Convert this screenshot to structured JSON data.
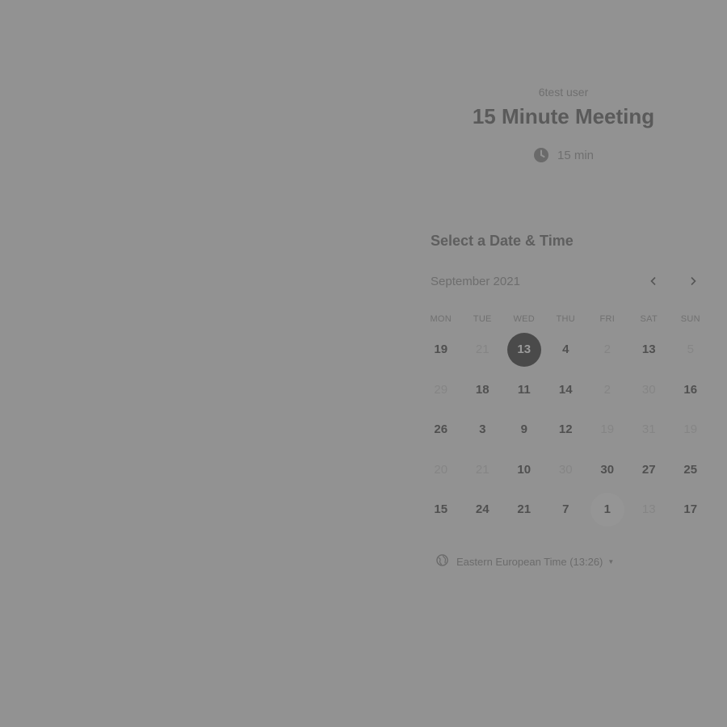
{
  "event": {
    "owner": "6test user",
    "title": "15 Minute Meeting",
    "duration": "15 min"
  },
  "scheduler": {
    "heading": "Select a Date & Time",
    "month": "September 2021",
    "weekdays": [
      "MON",
      "TUE",
      "WED",
      "THU",
      "FRI",
      "SAT",
      "SUN"
    ],
    "days": [
      {
        "label": "19",
        "state": "available"
      },
      {
        "label": "21",
        "state": "unavailable"
      },
      {
        "label": "13",
        "state": "selected"
      },
      {
        "label": "4",
        "state": "available"
      },
      {
        "label": "2",
        "state": "unavailable"
      },
      {
        "label": "13",
        "state": "available"
      },
      {
        "label": "5",
        "state": "unavailable"
      },
      {
        "label": "29",
        "state": "unavailable"
      },
      {
        "label": "18",
        "state": "available"
      },
      {
        "label": "11",
        "state": "available"
      },
      {
        "label": "14",
        "state": "available"
      },
      {
        "label": "2",
        "state": "unavailable"
      },
      {
        "label": "30",
        "state": "unavailable"
      },
      {
        "label": "16",
        "state": "available"
      },
      {
        "label": "26",
        "state": "available"
      },
      {
        "label": "3",
        "state": "available"
      },
      {
        "label": "9",
        "state": "available"
      },
      {
        "label": "12",
        "state": "available"
      },
      {
        "label": "19",
        "state": "unavailable"
      },
      {
        "label": "31",
        "state": "unavailable"
      },
      {
        "label": "19",
        "state": "unavailable"
      },
      {
        "label": "20",
        "state": "unavailable"
      },
      {
        "label": "21",
        "state": "unavailable"
      },
      {
        "label": "10",
        "state": "available"
      },
      {
        "label": "30",
        "state": "unavailable"
      },
      {
        "label": "30",
        "state": "available"
      },
      {
        "label": "27",
        "state": "available"
      },
      {
        "label": "25",
        "state": "available"
      },
      {
        "label": "15",
        "state": "available"
      },
      {
        "label": "24",
        "state": "available"
      },
      {
        "label": "21",
        "state": "available"
      },
      {
        "label": "7",
        "state": "available"
      },
      {
        "label": "1",
        "state": "today"
      },
      {
        "label": "13",
        "state": "unavailable"
      },
      {
        "label": "17",
        "state": "available"
      }
    ],
    "timezone": "Eastern European Time (13:26)"
  },
  "icons": {
    "duration": "clock-icon",
    "prev": "chevron-left-icon",
    "next": "chevron-right-icon",
    "timezone": "globe-icon",
    "dropdown": "caret-down-icon"
  }
}
